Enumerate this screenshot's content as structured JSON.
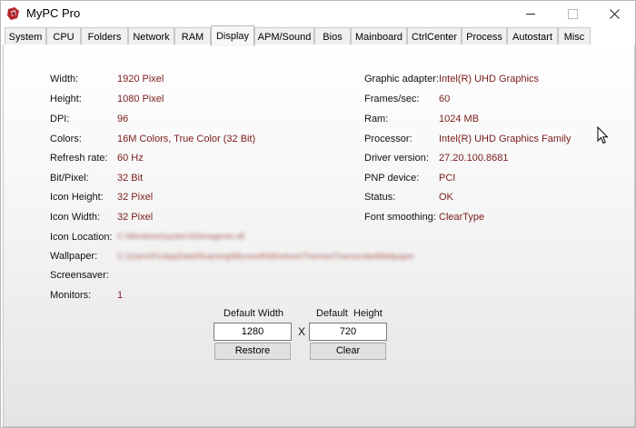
{
  "window": {
    "title": "MyPC Pro"
  },
  "tabs": [
    {
      "label": "System"
    },
    {
      "label": "CPU"
    },
    {
      "label": "Folders"
    },
    {
      "label": "Network"
    },
    {
      "label": "RAM"
    },
    {
      "label": "Display"
    },
    {
      "label": "APM/Sound"
    },
    {
      "label": "Bios"
    },
    {
      "label": "Mainboard"
    },
    {
      "label": "CtrlCenter"
    },
    {
      "label": "Process"
    },
    {
      "label": "Autostart"
    },
    {
      "label": "Misc"
    }
  ],
  "active_tab": "Display",
  "left": [
    {
      "label": "Width:",
      "value": "1920 Pixel"
    },
    {
      "label": "Height:",
      "value": "1080 Pixel"
    },
    {
      "label": "DPI:",
      "value": "96"
    },
    {
      "label": "Colors:",
      "value": "16M Colors, True Color (32 Bit)"
    },
    {
      "label": "Refresh rate:",
      "value": "60 Hz"
    },
    {
      "label": "Bit/Pixel:",
      "value": "32 Bit"
    },
    {
      "label": "Icon Height:",
      "value": "32 Pixel"
    },
    {
      "label": "Icon Width:",
      "value": "32 Pixel"
    },
    {
      "label": "Icon Location:",
      "value": "C:\\Windows\\system32\\imageres.dll"
    },
    {
      "label": "Wallpaper:",
      "value": "C:\\Users\\Pc\\AppData\\Roaming\\Microsoft\\Windows\\Themes\\TranscodedWallpaper"
    },
    {
      "label": "Screensaver:",
      "value": ""
    },
    {
      "label": "Monitors:",
      "value": "1"
    }
  ],
  "right": [
    {
      "label": "Graphic adapter:",
      "value": "Intel(R) UHD Graphics"
    },
    {
      "label": "Frames/sec:",
      "value": "60"
    },
    {
      "label": "Ram:",
      "value": "1024 MB"
    },
    {
      "label": "Processor:",
      "value": "Intel(R) UHD Graphics Family"
    },
    {
      "label": "Driver version:",
      "value": "27.20.100.8681"
    },
    {
      "label": "PNP device:",
      "value": "PCI"
    },
    {
      "label": "Status:",
      "value": "OK"
    },
    {
      "label": "Font smoothing:",
      "value": "ClearType"
    }
  ],
  "defaults": {
    "width_label": "Default Width",
    "height_label": "Default  Height",
    "width_value": "1280",
    "height_value": "720",
    "separator": "X",
    "restore_label": "Restore",
    "clear_label": "Clear"
  },
  "colors": {
    "value_text": "#7a1c1c",
    "tab_active_bg": "#f7f7f7"
  }
}
